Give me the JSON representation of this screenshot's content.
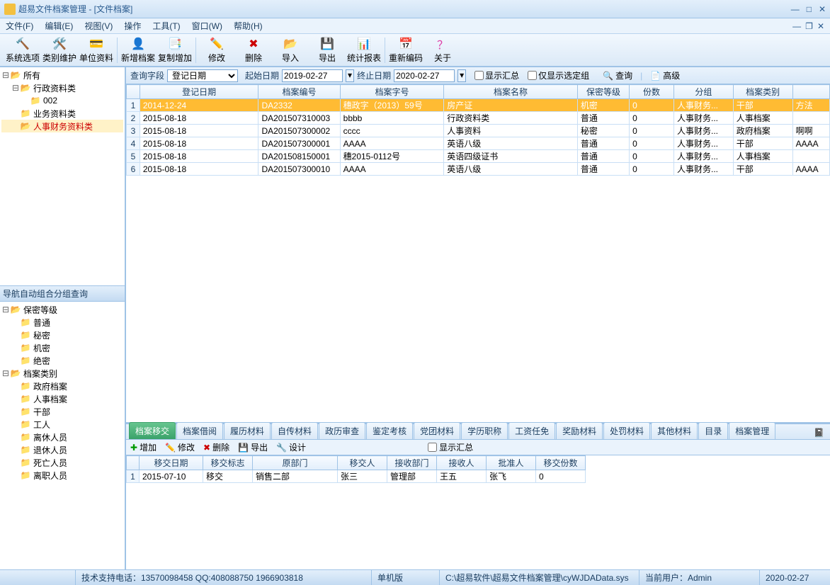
{
  "window": {
    "title": "超易文件档案管理 - [文件档案]"
  },
  "menu": {
    "file": "文件(F)",
    "edit": "编辑(E)",
    "view": "视图(V)",
    "operate": "操作",
    "tools": "工具(T)",
    "window": "窗口(W)",
    "help": "帮助(H)"
  },
  "toolbar": {
    "sysopt": "系统选项",
    "catmaint": "类别维护",
    "unit": "单位资料",
    "newrec": "新增档案",
    "copyadd": "复制增加",
    "modify": "修改",
    "delete": "删除",
    "import": "导入",
    "export": "导出",
    "report": "统计报表",
    "recode": "重新编码",
    "about": "关于"
  },
  "filter": {
    "field_label": "查询字段",
    "field_value": "登记日期",
    "start_label": "起始日期",
    "start_value": "2019-02-27",
    "end_label": "终止日期",
    "end_value": "2020-02-27",
    "show_summary": "显示汇总",
    "only_sel_grp": "仅显示选定组",
    "query": "查询",
    "advanced": "高级"
  },
  "tree_top": {
    "root": "所有",
    "items": [
      {
        "label": "行政资料类"
      },
      {
        "label": "002"
      },
      {
        "label": "业务资料类"
      },
      {
        "label": "人事财务资料类"
      }
    ]
  },
  "nav_header": "导航自动组合分组查询",
  "tree_bottom": {
    "g1": "保密等级",
    "g1items": [
      "普通",
      "秘密",
      "机密",
      "绝密"
    ],
    "g2": "档案类别",
    "g2items": [
      "政府档案",
      "人事档案",
      "干部",
      "工人",
      "离休人员",
      "退休人员",
      "死亡人员",
      "离职人员"
    ]
  },
  "grid": {
    "headers": [
      "登记日期",
      "档案编号",
      "档案字号",
      "档案名称",
      "保密等级",
      "份数",
      "分组",
      "档案类别",
      ""
    ],
    "rows": [
      {
        "n": "1",
        "date": "2014-12-24",
        "code": "DA2332",
        "zihao": "穗政字（2013）59号",
        "name": "房产证",
        "lvl": "机密",
        "qty": "0",
        "grp": "人事财务...",
        "cat": "干部",
        "extra": "方法"
      },
      {
        "n": "2",
        "date": "2015-08-18",
        "code": "DA201507310003",
        "zihao": "bbbb",
        "name": "行政资料类",
        "lvl": "普通",
        "qty": "0",
        "grp": "人事财务...",
        "cat": "人事档案",
        "extra": ""
      },
      {
        "n": "3",
        "date": "2015-08-18",
        "code": "DA201507300002",
        "zihao": "cccc",
        "name": "人事资料",
        "lvl": "秘密",
        "qty": "0",
        "grp": "人事财务...",
        "cat": "政府档案",
        "extra": "啊啊"
      },
      {
        "n": "4",
        "date": "2015-08-18",
        "code": "DA201507300001",
        "zihao": "AAAA",
        "name": "英语八级",
        "lvl": "普通",
        "qty": "0",
        "grp": "人事财务...",
        "cat": "干部",
        "extra": "AAAA"
      },
      {
        "n": "5",
        "date": "2015-08-18",
        "code": "DA201508150001",
        "zihao": "穗2015-0112号",
        "name": "英语四级证书",
        "lvl": "普通",
        "qty": "0",
        "grp": "人事财务...",
        "cat": "人事档案",
        "extra": ""
      },
      {
        "n": "6",
        "date": "2015-08-18",
        "code": "DA201507300010",
        "zihao": "AAAA",
        "name": "英语八级",
        "lvl": "普通",
        "qty": "0",
        "grp": "人事财务...",
        "cat": "干部",
        "extra": "AAAA"
      }
    ]
  },
  "detail_tabs": [
    "档案移交",
    "档案借阅",
    "履历材料",
    "自传材料",
    "政历审查",
    "鉴定考核",
    "党团材料",
    "学历职称",
    "工资任免",
    "奖励材料",
    "处罚材料",
    "其他材料",
    "目录",
    "档案管理"
  ],
  "subtool": {
    "add": "增加",
    "modify": "修改",
    "delete": "删除",
    "export": "导出",
    "design": "设计",
    "show_summary": "显示汇总"
  },
  "detail_grid": {
    "headers": [
      "移交日期",
      "移交标志",
      "原部门",
      "移交人",
      "接收部门",
      "接收人",
      "批准人",
      "移交份数"
    ],
    "row": {
      "n": "1",
      "date": "2015-07-10",
      "flag": "移交",
      "dept": "销售二部",
      "person": "张三",
      "recv_dept": "管理部",
      "recv": "王五",
      "approver": "张飞",
      "qty": "0"
    }
  },
  "status": {
    "tech": "技术支持电话：13570098458 QQ:408088750 1966903818",
    "mode": "单机版",
    "path": "C:\\超易软件\\超易文件档案管理\\cyWJDAData.sys",
    "user_label": "当前用户：Admin",
    "date": "2020-02-27"
  }
}
